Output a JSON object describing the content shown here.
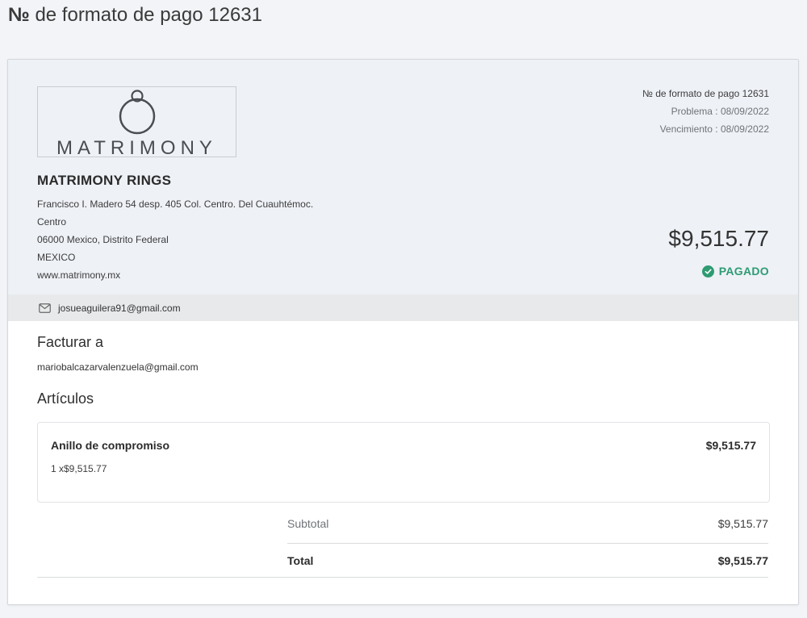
{
  "page": {
    "title_prefix": "№",
    "title_rest": "de formato de pago 12631"
  },
  "invoice": {
    "logo_text": "MATRIMONY",
    "company_name": "MATRIMONY RINGS",
    "address_lines": [
      "Francisco I. Madero 54 desp. 405 Col. Centro. Del Cuauhtémoc.",
      "Centro",
      "06000 Mexico, Distrito Federal",
      "MEXICO",
      "www.matrimony.mx"
    ],
    "number_label": "№ de formato de pago 12631",
    "issue_label": "Problema : 08/09/2022",
    "due_label": "Vencimiento : 08/09/2022",
    "amount": "$9,515.77",
    "status": "PAGADO",
    "status_color": "#2e9b73",
    "sender_email": "josueaguilera91@gmail.com"
  },
  "billing": {
    "title": "Facturar a",
    "email": "mariobalcazarvalenzuela@gmail.com"
  },
  "items": {
    "title": "Artículos",
    "list": [
      {
        "name": "Anillo de compromiso",
        "price": "$9,515.77",
        "qty": "1 x$9,515.77"
      }
    ]
  },
  "summary": {
    "subtotal_label": "Subtotal",
    "subtotal_value": "$9,515.77",
    "total_label": "Total",
    "total_value": "$9,515.77"
  }
}
